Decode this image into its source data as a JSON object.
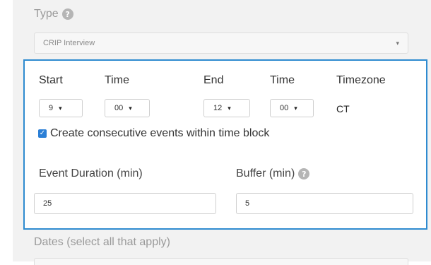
{
  "type_field": {
    "label": "Type",
    "help_icon": "?",
    "value": "CRIP Interview",
    "caret": "▾"
  },
  "time_block": {
    "headers": {
      "start": "Start",
      "start_time": "Time",
      "end": "End",
      "end_time": "Time",
      "timezone": "Timezone"
    },
    "start_hour": "9",
    "start_minute": "00",
    "end_hour": "12",
    "end_minute": "00",
    "timezone_value": "CT",
    "caret": "▾",
    "consecutive": {
      "checked": true,
      "check_glyph": "✓",
      "label": "Create consecutive events within time block"
    },
    "event_duration": {
      "label": "Event Duration (min)",
      "value": "25"
    },
    "buffer": {
      "label": "Buffer (min)",
      "help_icon": "?",
      "value": "5"
    }
  },
  "dates_field": {
    "label": "Dates (select all that apply)"
  },
  "colors": {
    "accent": "#2e8bd0",
    "checkbox": "#2b7fd6",
    "muted_label": "#9a9a9a"
  }
}
